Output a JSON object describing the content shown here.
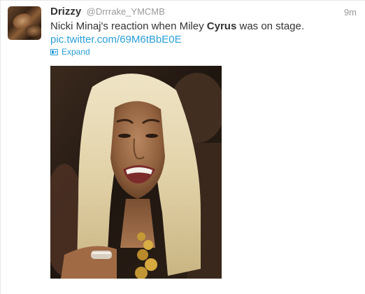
{
  "tweet": {
    "display_name": "Drizzy",
    "handle": "@Drrrake_YMCMB",
    "timestamp": "9m",
    "text_before": "Nicki Minaj's reaction when Miley ",
    "text_bold": "Cyrus",
    "text_after": " was on stage.",
    "link": "pic.twitter.com/69M6tBbE0E",
    "expand_label": "Expand"
  },
  "colors": {
    "link": "#2a9fd6",
    "meta_text": "#999999",
    "body_text": "#333333"
  },
  "icons": {
    "expand": "photo-card-icon"
  }
}
